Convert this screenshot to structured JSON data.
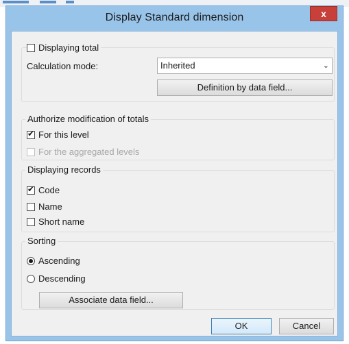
{
  "dialog": {
    "title": "Display Standard dimension",
    "close_label": "x"
  },
  "totals": {
    "displaying_total_label": "Displaying total",
    "displaying_total_checked": false,
    "calc_mode_label": "Calculation mode:",
    "calc_mode_value": "Inherited",
    "definition_button": "Definition by data field..."
  },
  "authorize": {
    "title": "Authorize modification of totals",
    "for_this_level": "For this level",
    "for_this_level_checked": true,
    "for_aggregated": "For the aggregated levels",
    "for_aggregated_checked": false
  },
  "records": {
    "title": "Displaying records",
    "code": "Code",
    "code_checked": true,
    "name": "Name",
    "name_checked": false,
    "short_name": "Short name",
    "short_name_checked": false
  },
  "sorting": {
    "title": "Sorting",
    "ascending": "Ascending",
    "descending": "Descending",
    "selected": "Ascending",
    "associate_button": "Associate data field..."
  },
  "footer": {
    "ok": "OK",
    "cancel": "Cancel"
  }
}
